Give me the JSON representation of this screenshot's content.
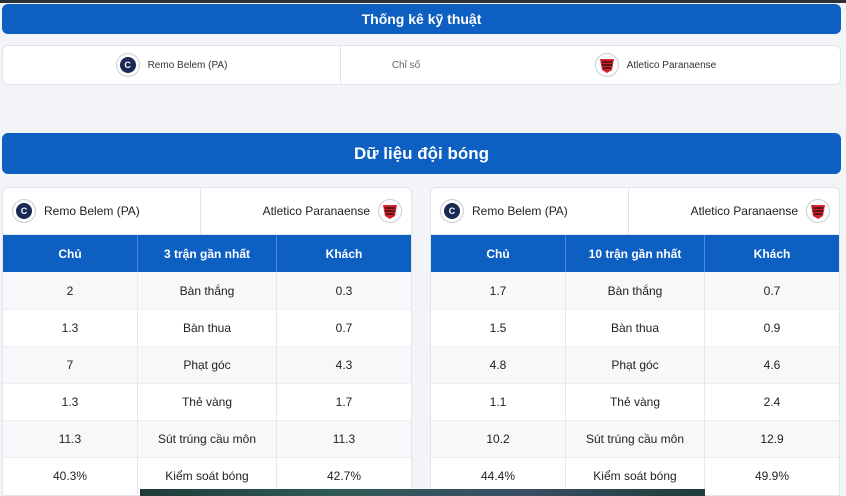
{
  "technical": {
    "title": "Thống kê kỹ thuật",
    "home_team": "Remo Belem (PA)",
    "middle_label": "Chỉ số",
    "away_team": "Atletico Paranaense"
  },
  "team_data": {
    "title": "Dữ liệu đội bóng",
    "cards": [
      {
        "home_team": "Remo Belem (PA)",
        "away_team": "Atletico Paranaense",
        "header": {
          "home": "Chủ",
          "period": "3 trận gần nhất",
          "away": "Khách"
        },
        "rows": [
          {
            "home": "2",
            "label": "Bàn thắng",
            "away": "0.3"
          },
          {
            "home": "1.3",
            "label": "Bàn thua",
            "away": "0.7"
          },
          {
            "home": "7",
            "label": "Phạt góc",
            "away": "4.3"
          },
          {
            "home": "1.3",
            "label": "Thẻ vàng",
            "away": "1.7"
          },
          {
            "home": "11.3",
            "label": "Sút trúng cầu môn",
            "away": "11.3"
          },
          {
            "home": "40.3%",
            "label": "Kiểm soát bóng",
            "away": "42.7%"
          }
        ]
      },
      {
        "home_team": "Remo Belem (PA)",
        "away_team": "Atletico Paranaense",
        "header": {
          "home": "Chủ",
          "period": "10 trận gần nhất",
          "away": "Khách"
        },
        "rows": [
          {
            "home": "1.7",
            "label": "Bàn thắng",
            "away": "0.7"
          },
          {
            "home": "1.5",
            "label": "Bàn thua",
            "away": "0.9"
          },
          {
            "home": "4.8",
            "label": "Phạt góc",
            "away": "4.6"
          },
          {
            "home": "1.1",
            "label": "Thẻ vàng",
            "away": "2.4"
          },
          {
            "home": "10.2",
            "label": "Sút trúng cầu môn",
            "away": "12.9"
          },
          {
            "home": "44.4%",
            "label": "Kiểm soát bóng",
            "away": "49.9%"
          }
        ]
      }
    ]
  },
  "icons": {
    "home_logo": "remo-crest-icon",
    "away_logo": "athletico-crest-icon"
  },
  "colors": {
    "accent": "#0d5fc2",
    "away_red": "#d3212d",
    "home_navy": "#1b2a55"
  }
}
